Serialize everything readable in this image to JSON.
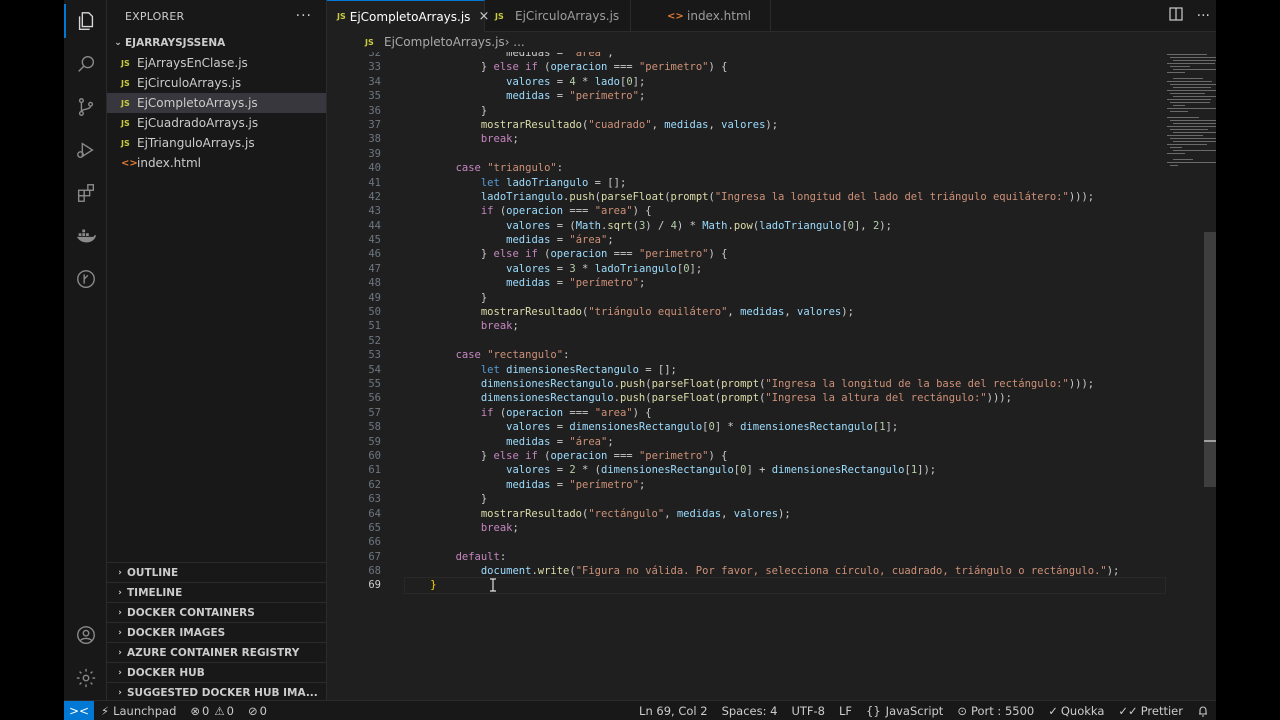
{
  "sidebar": {
    "title": "EXPLORER",
    "more": "···",
    "folder": "EJARRAYSJSSENA",
    "files": [
      {
        "name": "EjArraysEnClase.js",
        "icon": "js-file-icon",
        "badge": "JS"
      },
      {
        "name": "EjCirculoArrays.js",
        "icon": "js-file-icon",
        "badge": "JS"
      },
      {
        "name": "EjCompletoArrays.js",
        "icon": "js-file-icon",
        "badge": "JS",
        "selected": true
      },
      {
        "name": "EjCuadradoArrays.js",
        "icon": "js-file-icon",
        "badge": "JS"
      },
      {
        "name": "EjTrianguloArrays.js",
        "icon": "js-file-icon",
        "badge": "JS"
      },
      {
        "name": "index.html",
        "icon": "html-file-icon",
        "badge": "<>"
      }
    ],
    "panels": [
      "OUTLINE",
      "TIMELINE",
      "DOCKER CONTAINERS",
      "DOCKER IMAGES",
      "AZURE CONTAINER REGISTRY",
      "DOCKER HUB",
      "SUGGESTED DOCKER HUB IMA..."
    ]
  },
  "tabs": [
    {
      "label": "EjCompletoArrays.js",
      "badge": "JS",
      "close": "×"
    },
    {
      "label": "EjCirculoArrays.js",
      "badge": "JS"
    },
    {
      "label": "index.html",
      "badge": "<>"
    }
  ],
  "breadcrumb": {
    "file": "EjCompletoArrays.js",
    "badge": "JS",
    "sep": " › ..."
  },
  "editor": {
    "first_line": 32,
    "current_line": 69,
    "lines": [
      [
        [
          "                medidas = ",
          "pu"
        ],
        [
          "\"área\"",
          "str"
        ],
        [
          ";",
          "pu"
        ]
      ],
      [
        [
          "            } ",
          "pu"
        ],
        [
          "else if",
          "kw"
        ],
        [
          " (",
          "pu"
        ],
        [
          "operacion",
          "var"
        ],
        [
          " === ",
          "pu"
        ],
        [
          "\"perimetro\"",
          "str"
        ],
        [
          ") {",
          "pu"
        ]
      ],
      [
        [
          "                ",
          "pu"
        ],
        [
          "valores",
          "var"
        ],
        [
          " = ",
          "pu"
        ],
        [
          "4",
          "num"
        ],
        [
          " * ",
          "pu"
        ],
        [
          "lado",
          "var"
        ],
        [
          "[",
          "pu"
        ],
        [
          "0",
          "num"
        ],
        [
          "];",
          "pu"
        ]
      ],
      [
        [
          "                ",
          "pu"
        ],
        [
          "medidas",
          "var"
        ],
        [
          " = ",
          "pu"
        ],
        [
          "\"perímetro\"",
          "str"
        ],
        [
          ";",
          "pu"
        ]
      ],
      [
        [
          "            }",
          "pu"
        ]
      ],
      [
        [
          "            ",
          "pu"
        ],
        [
          "mostrarResultado",
          "fn"
        ],
        [
          "(",
          "pu"
        ],
        [
          "\"cuadrado\"",
          "str"
        ],
        [
          ", ",
          "pu"
        ],
        [
          "medidas",
          "var"
        ],
        [
          ", ",
          "pu"
        ],
        [
          "valores",
          "var"
        ],
        [
          ");",
          "pu"
        ]
      ],
      [
        [
          "            ",
          "pu"
        ],
        [
          "break",
          "kw"
        ],
        [
          ";",
          "pu"
        ]
      ],
      [
        [
          "",
          "pu"
        ]
      ],
      [
        [
          "        ",
          "pu"
        ],
        [
          "case",
          "kw"
        ],
        [
          " ",
          "pu"
        ],
        [
          "\"triangulo\"",
          "str"
        ],
        [
          ":",
          "pu"
        ]
      ],
      [
        [
          "            ",
          "pu"
        ],
        [
          "let",
          "k2"
        ],
        [
          " ",
          "pu"
        ],
        [
          "ladoTriangulo",
          "var"
        ],
        [
          " = [];",
          "pu"
        ]
      ],
      [
        [
          "            ",
          "pu"
        ],
        [
          "ladoTriangulo",
          "var"
        ],
        [
          ".",
          "pu"
        ],
        [
          "push",
          "fn"
        ],
        [
          "(",
          "pu"
        ],
        [
          "parseFloat",
          "fn"
        ],
        [
          "(",
          "pu"
        ],
        [
          "prompt",
          "fn"
        ],
        [
          "(",
          "pu"
        ],
        [
          "\"Ingresa la longitud del lado del triángulo equilátero:\"",
          "str"
        ],
        [
          ")));",
          "pu"
        ]
      ],
      [
        [
          "            ",
          "pu"
        ],
        [
          "if",
          "kw"
        ],
        [
          " (",
          "pu"
        ],
        [
          "operacion",
          "var"
        ],
        [
          " === ",
          "pu"
        ],
        [
          "\"area\"",
          "str"
        ],
        [
          ") {",
          "pu"
        ]
      ],
      [
        [
          "                ",
          "pu"
        ],
        [
          "valores",
          "var"
        ],
        [
          " = (",
          "pu"
        ],
        [
          "Math",
          "var"
        ],
        [
          ".",
          "pu"
        ],
        [
          "sqrt",
          "fn"
        ],
        [
          "(",
          "pu"
        ],
        [
          "3",
          "num"
        ],
        [
          ") / ",
          "pu"
        ],
        [
          "4",
          "num"
        ],
        [
          ") * ",
          "pu"
        ],
        [
          "Math",
          "var"
        ],
        [
          ".",
          "pu"
        ],
        [
          "pow",
          "fn"
        ],
        [
          "(",
          "pu"
        ],
        [
          "ladoTriangulo",
          "var"
        ],
        [
          "[",
          "pu"
        ],
        [
          "0",
          "num"
        ],
        [
          "], ",
          "pu"
        ],
        [
          "2",
          "num"
        ],
        [
          ");",
          "pu"
        ]
      ],
      [
        [
          "                ",
          "pu"
        ],
        [
          "medidas",
          "var"
        ],
        [
          " = ",
          "pu"
        ],
        [
          "\"área\"",
          "str"
        ],
        [
          ";",
          "pu"
        ]
      ],
      [
        [
          "            } ",
          "pu"
        ],
        [
          "else if",
          "kw"
        ],
        [
          " (",
          "pu"
        ],
        [
          "operacion",
          "var"
        ],
        [
          " === ",
          "pu"
        ],
        [
          "\"perimetro\"",
          "str"
        ],
        [
          ") {",
          "pu"
        ]
      ],
      [
        [
          "                ",
          "pu"
        ],
        [
          "valores",
          "var"
        ],
        [
          " = ",
          "pu"
        ],
        [
          "3",
          "num"
        ],
        [
          " * ",
          "pu"
        ],
        [
          "ladoTriangulo",
          "var"
        ],
        [
          "[",
          "pu"
        ],
        [
          "0",
          "num"
        ],
        [
          "];",
          "pu"
        ]
      ],
      [
        [
          "                ",
          "pu"
        ],
        [
          "medidas",
          "var"
        ],
        [
          " = ",
          "pu"
        ],
        [
          "\"perímetro\"",
          "str"
        ],
        [
          ";",
          "pu"
        ]
      ],
      [
        [
          "            }",
          "pu"
        ]
      ],
      [
        [
          "            ",
          "pu"
        ],
        [
          "mostrarResultado",
          "fn"
        ],
        [
          "(",
          "pu"
        ],
        [
          "\"triángulo equilátero\"",
          "str"
        ],
        [
          ", ",
          "pu"
        ],
        [
          "medidas",
          "var"
        ],
        [
          ", ",
          "pu"
        ],
        [
          "valores",
          "var"
        ],
        [
          ");",
          "pu"
        ]
      ],
      [
        [
          "            ",
          "pu"
        ],
        [
          "break",
          "kw"
        ],
        [
          ";",
          "pu"
        ]
      ],
      [
        [
          "",
          "pu"
        ]
      ],
      [
        [
          "        ",
          "pu"
        ],
        [
          "case",
          "kw"
        ],
        [
          " ",
          "pu"
        ],
        [
          "\"rectangulo\"",
          "str"
        ],
        [
          ":",
          "pu"
        ]
      ],
      [
        [
          "            ",
          "pu"
        ],
        [
          "let",
          "k2"
        ],
        [
          " ",
          "pu"
        ],
        [
          "dimensionesRectangulo",
          "var"
        ],
        [
          " = [];",
          "pu"
        ]
      ],
      [
        [
          "            ",
          "pu"
        ],
        [
          "dimensionesRectangulo",
          "var"
        ],
        [
          ".",
          "pu"
        ],
        [
          "push",
          "fn"
        ],
        [
          "(",
          "pu"
        ],
        [
          "parseFloat",
          "fn"
        ],
        [
          "(",
          "pu"
        ],
        [
          "prompt",
          "fn"
        ],
        [
          "(",
          "pu"
        ],
        [
          "\"Ingresa la longitud de la base del rectángulo:\"",
          "str"
        ],
        [
          ")));",
          "pu"
        ]
      ],
      [
        [
          "            ",
          "pu"
        ],
        [
          "dimensionesRectangulo",
          "var"
        ],
        [
          ".",
          "pu"
        ],
        [
          "push",
          "fn"
        ],
        [
          "(",
          "pu"
        ],
        [
          "parseFloat",
          "fn"
        ],
        [
          "(",
          "pu"
        ],
        [
          "prompt",
          "fn"
        ],
        [
          "(",
          "pu"
        ],
        [
          "\"Ingresa la altura del rectángulo:\"",
          "str"
        ],
        [
          ")));",
          "pu"
        ]
      ],
      [
        [
          "            ",
          "pu"
        ],
        [
          "if",
          "kw"
        ],
        [
          " (",
          "pu"
        ],
        [
          "operacion",
          "var"
        ],
        [
          " === ",
          "pu"
        ],
        [
          "\"area\"",
          "str"
        ],
        [
          ") {",
          "pu"
        ]
      ],
      [
        [
          "                ",
          "pu"
        ],
        [
          "valores",
          "var"
        ],
        [
          " = ",
          "pu"
        ],
        [
          "dimensionesRectangulo",
          "var"
        ],
        [
          "[",
          "pu"
        ],
        [
          "0",
          "num"
        ],
        [
          "] * ",
          "pu"
        ],
        [
          "dimensionesRectangulo",
          "var"
        ],
        [
          "[",
          "pu"
        ],
        [
          "1",
          "num"
        ],
        [
          "];",
          "pu"
        ]
      ],
      [
        [
          "                ",
          "pu"
        ],
        [
          "medidas",
          "var"
        ],
        [
          " = ",
          "pu"
        ],
        [
          "\"área\"",
          "str"
        ],
        [
          ";",
          "pu"
        ]
      ],
      [
        [
          "            } ",
          "pu"
        ],
        [
          "else if",
          "kw"
        ],
        [
          " (",
          "pu"
        ],
        [
          "operacion",
          "var"
        ],
        [
          " === ",
          "pu"
        ],
        [
          "\"perimetro\"",
          "str"
        ],
        [
          ") {",
          "pu"
        ]
      ],
      [
        [
          "                ",
          "pu"
        ],
        [
          "valores",
          "var"
        ],
        [
          " = ",
          "pu"
        ],
        [
          "2",
          "num"
        ],
        [
          " * (",
          "pu"
        ],
        [
          "dimensionesRectangulo",
          "var"
        ],
        [
          "[",
          "pu"
        ],
        [
          "0",
          "num"
        ],
        [
          "] + ",
          "pu"
        ],
        [
          "dimensionesRectangulo",
          "var"
        ],
        [
          "[",
          "pu"
        ],
        [
          "1",
          "num"
        ],
        [
          "]);",
          "pu"
        ]
      ],
      [
        [
          "                ",
          "pu"
        ],
        [
          "medidas",
          "var"
        ],
        [
          " = ",
          "pu"
        ],
        [
          "\"perímetro\"",
          "str"
        ],
        [
          ";",
          "pu"
        ]
      ],
      [
        [
          "            }",
          "pu"
        ]
      ],
      [
        [
          "            ",
          "pu"
        ],
        [
          "mostrarResultado",
          "fn"
        ],
        [
          "(",
          "pu"
        ],
        [
          "\"rectángulo\"",
          "str"
        ],
        [
          ", ",
          "pu"
        ],
        [
          "medidas",
          "var"
        ],
        [
          ", ",
          "pu"
        ],
        [
          "valores",
          "var"
        ],
        [
          ");",
          "pu"
        ]
      ],
      [
        [
          "            ",
          "pu"
        ],
        [
          "break",
          "kw"
        ],
        [
          ";",
          "pu"
        ]
      ],
      [
        [
          "",
          "pu"
        ]
      ],
      [
        [
          "        ",
          "pu"
        ],
        [
          "default",
          "kw"
        ],
        [
          ":",
          "pu"
        ]
      ],
      [
        [
          "            ",
          "pu"
        ],
        [
          "document",
          "var"
        ],
        [
          ".",
          "pu"
        ],
        [
          "write",
          "fn"
        ],
        [
          "(",
          "pu"
        ],
        [
          "\"Figura no válida. Por favor, selecciona círculo, cuadrado, triángulo o rectángulo.\"",
          "str"
        ],
        [
          ");",
          "pu"
        ]
      ],
      [
        [
          "    ",
          "pu"
        ],
        [
          "}",
          "br"
        ]
      ]
    ]
  },
  "status": {
    "remote": "><",
    "launchpad": "Launchpad",
    "errors": "0",
    "warnings": "0",
    "ports_count": "0",
    "position": "Ln 69, Col 2",
    "spaces": "Spaces: 4",
    "encoding": "UTF-8",
    "eol": "LF",
    "language": "JavaScript",
    "port": "Port : 5500",
    "quokka": "Quokka",
    "prettier": "Prettier"
  },
  "colors": {
    "accent": "#0078d4",
    "editor_bg": "#1f1f1f",
    "sidebar_bg": "#181818"
  }
}
